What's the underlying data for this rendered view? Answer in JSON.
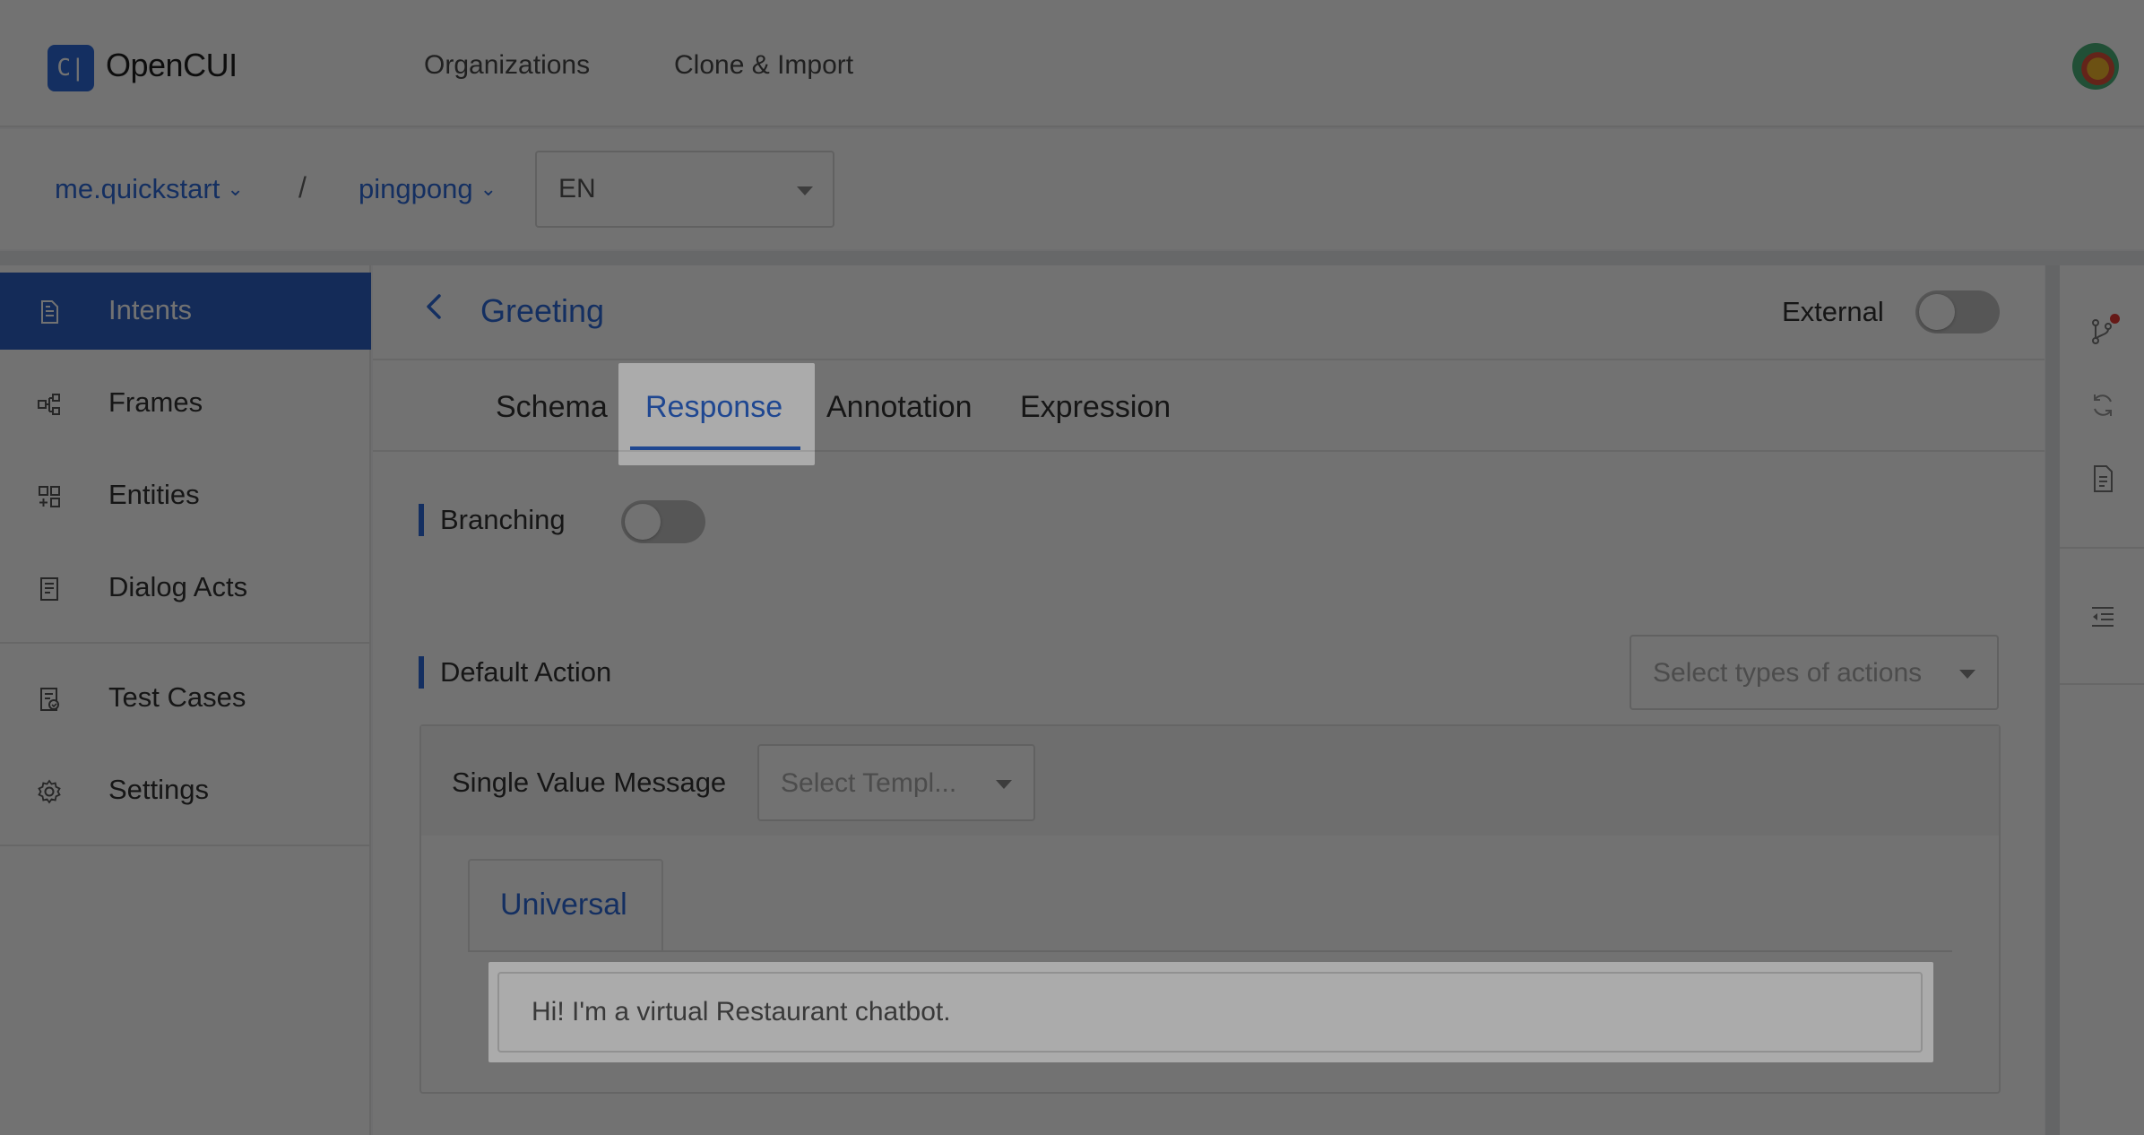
{
  "app": {
    "name": "OpenCUI",
    "logo_glyph": "C|"
  },
  "topnav": {
    "links": [
      "Organizations",
      "Clone & Import"
    ]
  },
  "breadcrumb": {
    "org": "me.quickstart",
    "project": "pingpong",
    "separator": "/",
    "language": "EN"
  },
  "sidebar": {
    "items": [
      {
        "label": "Intents",
        "icon": "document-icon",
        "active": true
      },
      {
        "label": "Frames",
        "icon": "frames-icon",
        "active": false
      },
      {
        "label": "Entities",
        "icon": "entities-icon",
        "active": false
      },
      {
        "label": "Dialog Acts",
        "icon": "dialog-acts-icon",
        "active": false
      },
      {
        "label": "Test Cases",
        "icon": "test-cases-icon",
        "active": false
      },
      {
        "label": "Settings",
        "icon": "gear-icon",
        "active": false
      }
    ]
  },
  "page": {
    "title": "Greeting",
    "external_label": "External",
    "external_on": false,
    "tabs": [
      "Schema",
      "Response",
      "Annotation",
      "Expression"
    ],
    "active_tab": "Response"
  },
  "response": {
    "branching_label": "Branching",
    "branching_on": false,
    "default_action_label": "Default Action",
    "action_types_placeholder": "Select types of actions",
    "single_value_label": "Single Value Message",
    "template_placeholder": "Select Templ...",
    "channel_tab": "Universal",
    "message": "Hi! I'm a virtual Restaurant chatbot."
  },
  "rail": {
    "icons": [
      "branch-icon",
      "refresh-icon",
      "file-icon",
      "indent-icon"
    ]
  },
  "colors": {
    "accent": "#2f6bd8",
    "sidebar_active": "#2f62c4",
    "notification": "#e53935"
  }
}
